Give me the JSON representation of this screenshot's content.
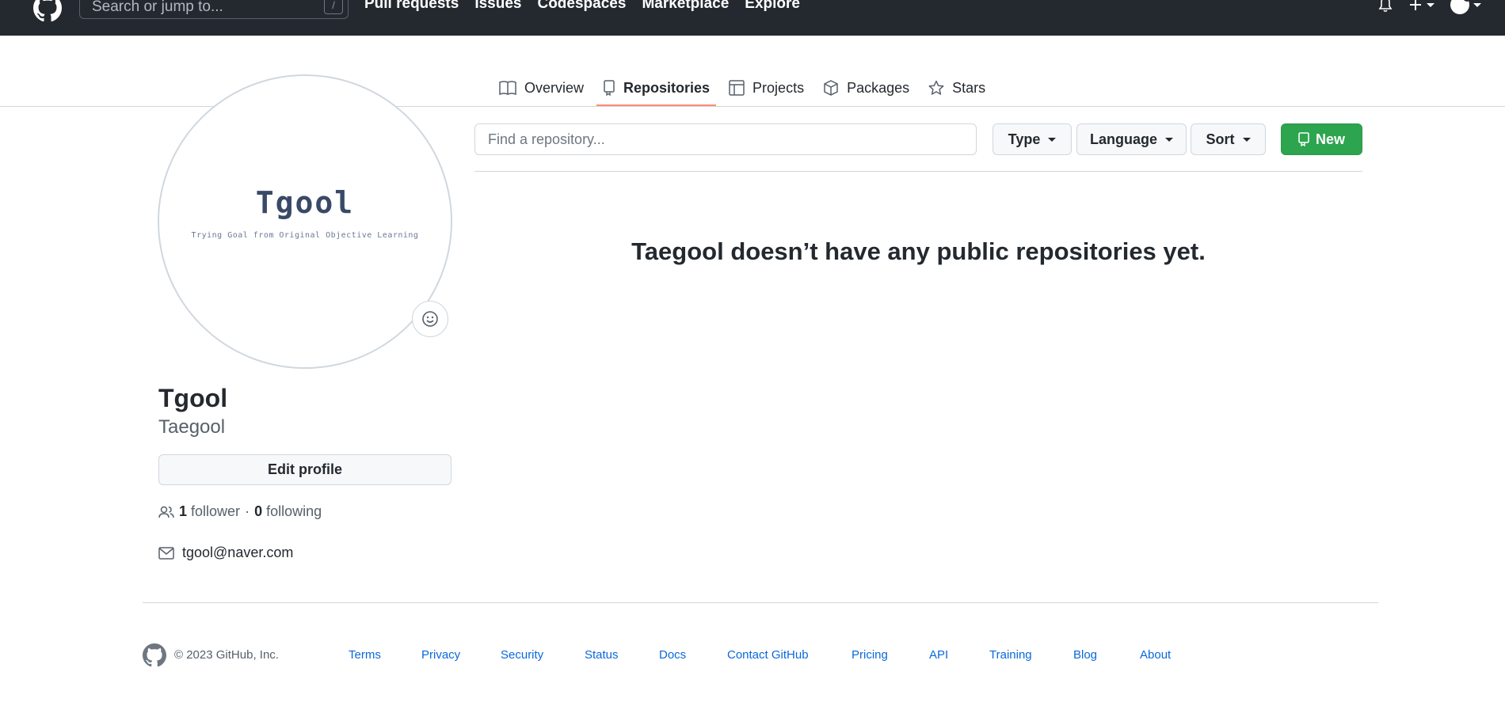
{
  "header": {
    "search_placeholder": "Search or jump to...",
    "slash_key": "/",
    "nav": [
      "Pull requests",
      "Issues",
      "Codespaces",
      "Marketplace",
      "Explore"
    ],
    "icons": [
      "bell-icon",
      "plus-icon",
      "avatar"
    ]
  },
  "tabs": [
    {
      "label": "Overview",
      "icon": "book-icon",
      "active": false
    },
    {
      "label": "Repositories",
      "icon": "repo-icon",
      "active": true
    },
    {
      "label": "Projects",
      "icon": "table-icon",
      "active": false
    },
    {
      "label": "Packages",
      "icon": "package-icon",
      "active": false
    },
    {
      "label": "Stars",
      "icon": "star-icon",
      "active": false
    }
  ],
  "profile": {
    "avatar_title": "Tgool",
    "avatar_subtitle": "Trying Goal from Original Objective Learning",
    "name": "Tgool",
    "login": "Taegool",
    "edit_label": "Edit profile",
    "followers_count": "1",
    "followers_label": "follower",
    "separator": "·",
    "following_count": "0",
    "following_label": "following",
    "email": "tgool@naver.com"
  },
  "repos": {
    "find_placeholder": "Find a repository...",
    "type_label": "Type",
    "language_label": "Language",
    "sort_label": "Sort",
    "new_label": "New",
    "empty_message": "Taegool doesn’t have any public repositories yet."
  },
  "footer": {
    "copyright": "© 2023 GitHub, Inc.",
    "links": [
      "Terms",
      "Privacy",
      "Security",
      "Status",
      "Docs",
      "Contact GitHub",
      "Pricing",
      "API",
      "Training",
      "Blog",
      "About"
    ]
  },
  "colors": {
    "header_bg": "#24292f",
    "tab_underline": "#fd8c73",
    "new_button": "#2da44e",
    "link": "#0969da"
  }
}
